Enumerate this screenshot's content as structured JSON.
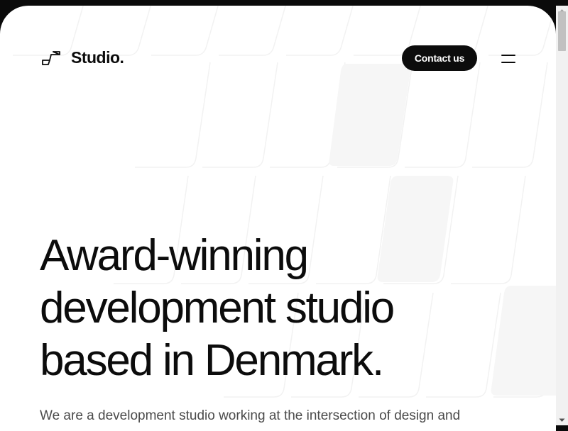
{
  "brand": {
    "logo_icon": "stair-step-icon",
    "name": "Studio."
  },
  "header": {
    "contact_label": "Contact us",
    "menu_icon": "hamburger-menu-icon"
  },
  "hero": {
    "title_lines": [
      "Award-winning",
      "development studio",
      "based in Denmark."
    ],
    "subtitle": "We are a development studio working at the intersection of design and"
  },
  "colors": {
    "background": "#ffffff",
    "text": "#0c0c0c",
    "muted_text": "#4a4a4a",
    "button_bg": "#0c0c0c",
    "button_text": "#ffffff",
    "frame": "#0a0a0a"
  }
}
